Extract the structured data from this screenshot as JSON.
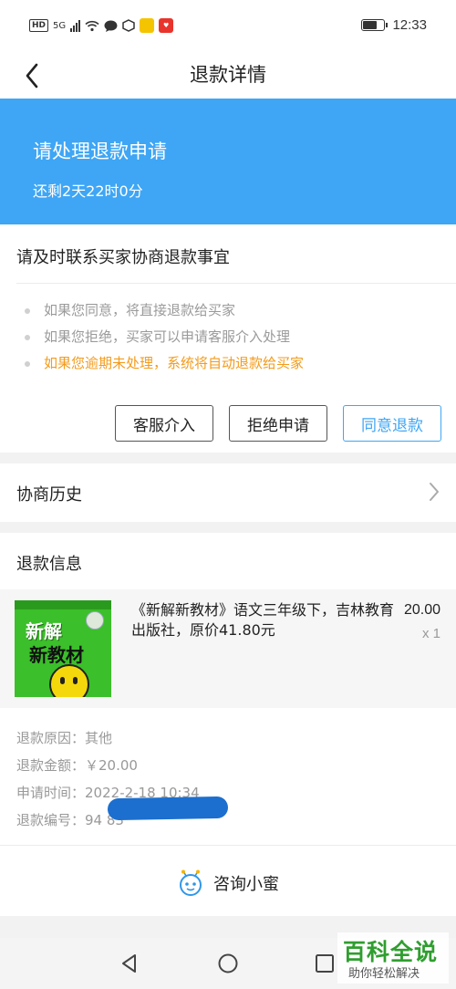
{
  "status_bar": {
    "hd": "HD",
    "network": "5G",
    "time": "12:33"
  },
  "nav": {
    "title": "退款详情"
  },
  "banner": {
    "title": "请处理退款申请",
    "subtitle": "还剩2天22时0分",
    "color": "#3ea6f5"
  },
  "notice": {
    "title": "请及时联系买家协商退款事宜",
    "bullets": [
      "如果您同意，将直接退款给买家",
      "如果您拒绝，买家可以申请客服介入处理",
      "如果您逾期未处理，系统将自动退款给买家"
    ],
    "warn_color": "#f39b1b",
    "buttons": {
      "service": "客服介入",
      "reject": "拒绝申请",
      "agree": "同意退款"
    }
  },
  "history": {
    "label": "协商历史"
  },
  "refund": {
    "title": "退款信息",
    "product": {
      "cover_title_1": "新解",
      "cover_title_2": "新教材",
      "name": "《新解新教材》语文三年级下，吉林教育出版社，原价41.80元",
      "price": "20.00",
      "qty": "x 1"
    },
    "rows": [
      {
        "label": "退款原因：",
        "value": "其他"
      },
      {
        "label": "退款金额：",
        "value": "￥20.00"
      },
      {
        "label": "申请时间：",
        "value": "2022-2-18 10:34"
      },
      {
        "label": "退款编号：",
        "value": "94                        83"
      }
    ],
    "consult_label": "咨询小蜜"
  },
  "watermark": {
    "main": "百科全说",
    "sub": "助你轻松解决"
  }
}
